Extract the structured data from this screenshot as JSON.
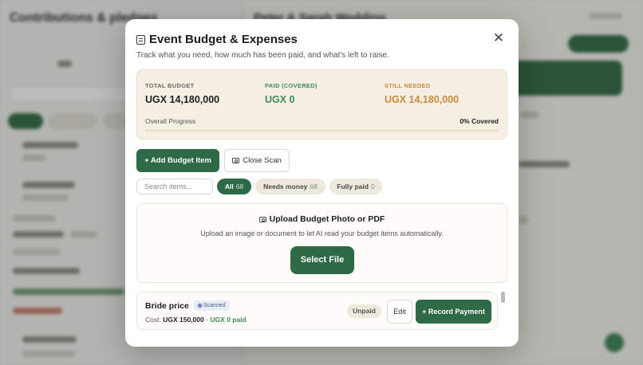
{
  "modal": {
    "title": "Event Budget & Expenses",
    "title_icon": "ledger-icon",
    "subtitle": "Track what you need, how much has been paid, and what's left to raise.",
    "close_label": "✕"
  },
  "summary": {
    "total_label": "TOTAL BUDGET",
    "total_value": "UGX 14,180,000",
    "paid_label": "PAID (COVERED)",
    "paid_value": "UGX 0",
    "needed_label": "STILL NEEDED",
    "needed_value": "UGX 14,180,000",
    "progress_label": "Overall Progress",
    "progress_value": "0% Covered",
    "progress_fraction": 0,
    "colors": {
      "total": "#1f1f1f",
      "paid": "#3e8a58",
      "needed": "#c98a3c"
    }
  },
  "actions": {
    "add_label": "+ Add Budget Item",
    "close_scan_label": "Close Scan",
    "close_scan_icon": "camera-icon"
  },
  "search": {
    "placeholder": "Search items..."
  },
  "filters": [
    {
      "label": "All",
      "count": "68",
      "active": true
    },
    {
      "label": "Needs money",
      "count": "68",
      "active": false
    },
    {
      "label": "Fully paid",
      "count": "0",
      "active": false
    }
  ],
  "upload": {
    "title": "Upload Budget Photo or PDF",
    "title_icon": "camera-icon",
    "subtitle": "Upload an image or document to let AI read your budget items automatically.",
    "button_label": "Select File"
  },
  "items": [
    {
      "name": "Bride price",
      "badge": "Scanned",
      "cost_prefix": "Cost:",
      "cost": "UGX 150,000",
      "separator": "·",
      "paid": "UGX 0 paid",
      "status": "Unpaid",
      "edit_label": "Edit",
      "record_label": "+ Record Payment"
    }
  ],
  "accent_color": "#2e6a45"
}
